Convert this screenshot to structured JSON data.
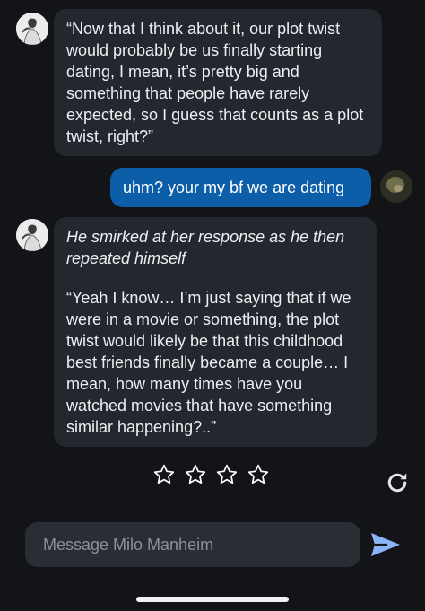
{
  "chat": {
    "character_name": "Milo Manheim",
    "messages": [
      {
        "sender": "character",
        "text": "“Now that I think about it, our plot twist would probably be us finally starting dating, I mean, it’s pretty big and something that people have rarely expected, so I guess that counts as a plot twist, right?”"
      },
      {
        "sender": "user",
        "text": "uhm? your my bf we are dating"
      },
      {
        "sender": "character",
        "action": "He smirked at her response as he then repeated himself",
        "text": "“Yeah I know… I’m just saying that if we were in a movie or something, the plot twist would likely be that this childhood best friends finally became a couple… I mean, how many times have you watched movies that have something similar happening?..”"
      }
    ],
    "rating": {
      "stars_total": 4,
      "stars_filled": 0
    }
  },
  "composer": {
    "placeholder": "Message Milo Manheim",
    "value": ""
  },
  "icons": {
    "star": "star-outline-icon",
    "regenerate": "refresh-icon",
    "send": "send-icon"
  },
  "colors": {
    "background": "#121418",
    "character_bubble": "#24272e",
    "user_bubble": "#0d5ea8",
    "send_icon": "#8ab4f8"
  }
}
